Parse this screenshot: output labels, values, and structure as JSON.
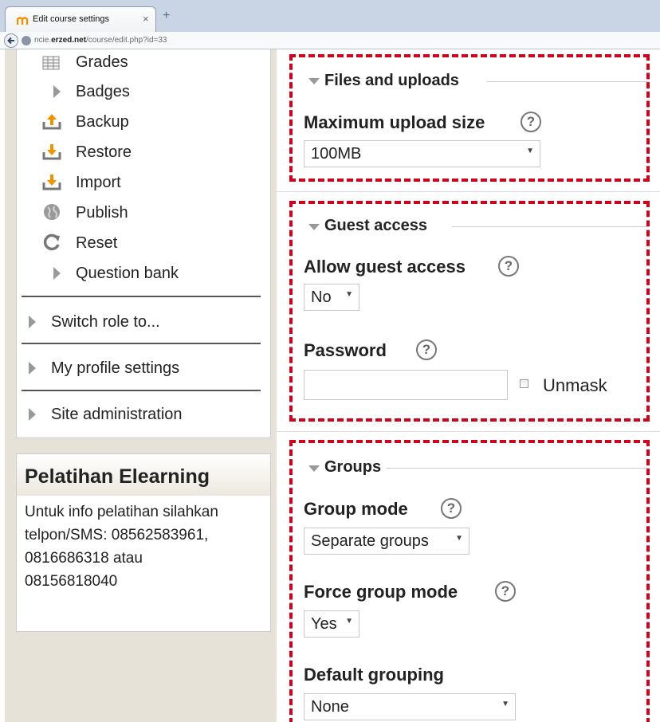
{
  "browser": {
    "tab_title": "Edit course settings",
    "close_glyph": "×",
    "newtab_glyph": "+",
    "url_prefix": "ncie.",
    "url_domain": "erzed.net",
    "url_path": "/course/edit.php?id=33"
  },
  "sidebar": {
    "items": [
      {
        "label": "Grades",
        "icon": "grades-table-icon"
      },
      {
        "label": "Badges",
        "icon": "expand-triangle-icon"
      },
      {
        "label": "Backup",
        "icon": "upload-icon"
      },
      {
        "label": "Restore",
        "icon": "download-icon"
      },
      {
        "label": "Import",
        "icon": "download-icon"
      },
      {
        "label": "Publish",
        "icon": "globe-icon"
      },
      {
        "label": "Reset",
        "icon": "reset-icon"
      },
      {
        "label": "Question bank",
        "icon": "expand-triangle-icon"
      }
    ],
    "sections": [
      {
        "label": "Switch role to..."
      },
      {
        "label": "My profile settings"
      },
      {
        "label": "Site administration"
      }
    ]
  },
  "info_block": {
    "title": "Pelatihan Elearning",
    "line1": "Untuk info pelatihan silahkan",
    "line2": "telpon/SMS: 08562583961,",
    "line3": "0816686318 atau",
    "line4": "08156818040"
  },
  "files": {
    "legend": "Files and uploads",
    "max_upload_label": "Maximum upload size",
    "max_upload_value": "100MB"
  },
  "guest": {
    "legend": "Guest access",
    "allow_label": "Allow guest access",
    "allow_value": "No",
    "password_label": "Password",
    "password_value": "",
    "unmask_label": "Unmask"
  },
  "groups": {
    "legend": "Groups",
    "group_mode_label": "Group mode",
    "group_mode_value": "Separate groups",
    "force_label": "Force group mode",
    "force_value": "Yes",
    "default_grouping_label": "Default grouping",
    "default_grouping_value": "None"
  },
  "help_glyph": "?",
  "select_arrow": "▼",
  "colors": {
    "highlight_border": "#d0021b",
    "sidebar_bg": "#e6e2d8",
    "chrome_bg": "#c9d5e4"
  }
}
